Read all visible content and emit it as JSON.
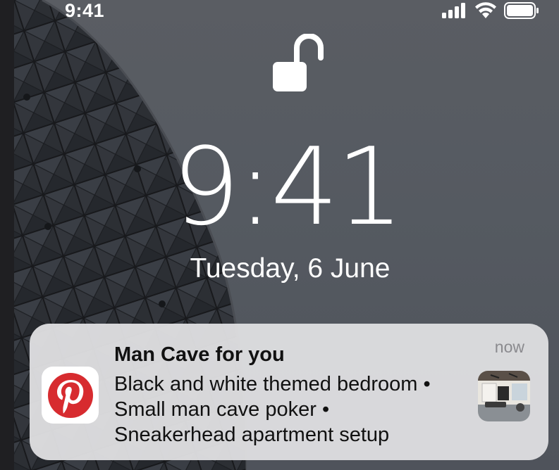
{
  "status_bar": {
    "time": "9:41",
    "icons": [
      "cellular-signal-icon",
      "wifi-icon",
      "battery-icon"
    ]
  },
  "lock_screen": {
    "lock_state_icon": "unlocked-padlock-icon",
    "time": "9:41",
    "date": "Tuesday, 6 June"
  },
  "notification": {
    "app_icon": "pinterest-icon",
    "title": "Man Cave for you",
    "timestamp": "now",
    "body_lines": [
      "Black and white themed bedroom •",
      "Small man cave poker •",
      "Sneakerhead apartment setup"
    ],
    "thumbnail": "room-photo-thumbnail"
  },
  "colors": {
    "background": "#55595f",
    "notification_bg": "#dddddf",
    "pinterest_red": "#d72b2f",
    "timestamp_gray": "#8a8a8e"
  }
}
